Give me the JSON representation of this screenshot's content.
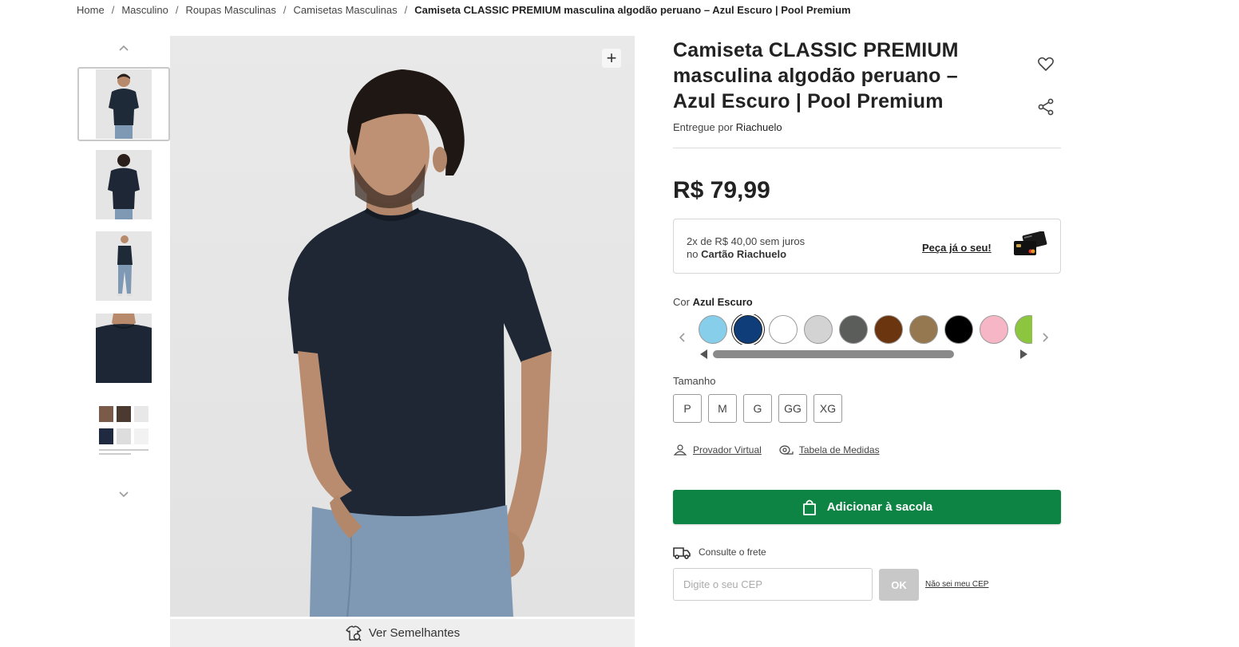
{
  "breadcrumb": {
    "items": [
      "Home",
      "Masculino",
      "Roupas Masculinas",
      "Camisetas Masculinas"
    ],
    "current": "Camiseta CLASSIC PREMIUM masculina algodão peruano – Azul Escuro | Pool Premium",
    "separator": "/"
  },
  "product": {
    "title": "Camiseta CLASSIC PREMIUM masculina algodão peruano – Azul Escuro | Pool Premium",
    "delivered_prefix": "Entregue por",
    "delivered_by": "Riachuelo",
    "price": "R$ 79,99"
  },
  "gallery": {
    "thumbnails": [
      "front",
      "back",
      "full-body",
      "detail",
      "catalog"
    ],
    "active_index": 0,
    "zoom_label": "+",
    "similar_label": "Ver Semelhantes"
  },
  "installment": {
    "line1": "2x de R$ 40,00 sem juros",
    "line2_prefix": "no",
    "line2_card": "Cartão Riachuelo",
    "link": "Peça já o seu!"
  },
  "color": {
    "label": "Cor",
    "selected": "Azul Escuro",
    "swatches": [
      "#87ceeb",
      "#0e3d7a",
      "#ffffff",
      "#d3d3d3",
      "#5b5d5b",
      "#6b3510",
      "#967850",
      "#000000",
      "#f7b6c6",
      "#8cc63f"
    ],
    "selected_index": 1
  },
  "size": {
    "label": "Tamanho",
    "options": [
      "P",
      "M",
      "G",
      "GG",
      "XG"
    ]
  },
  "fit": {
    "virtual_label": "Provador Virtual",
    "table_label": "Tabela de Medidas"
  },
  "cart": {
    "add_label": "Adicionar à sacola"
  },
  "shipping": {
    "label": "Consulte o frete",
    "placeholder": "Digite o seu CEP",
    "ok_label": "OK",
    "no_cep_label": "Não sei meu CEP"
  },
  "colors": {
    "primary_green": "#0d8443",
    "ok_disabled": "#c8c8c8"
  }
}
